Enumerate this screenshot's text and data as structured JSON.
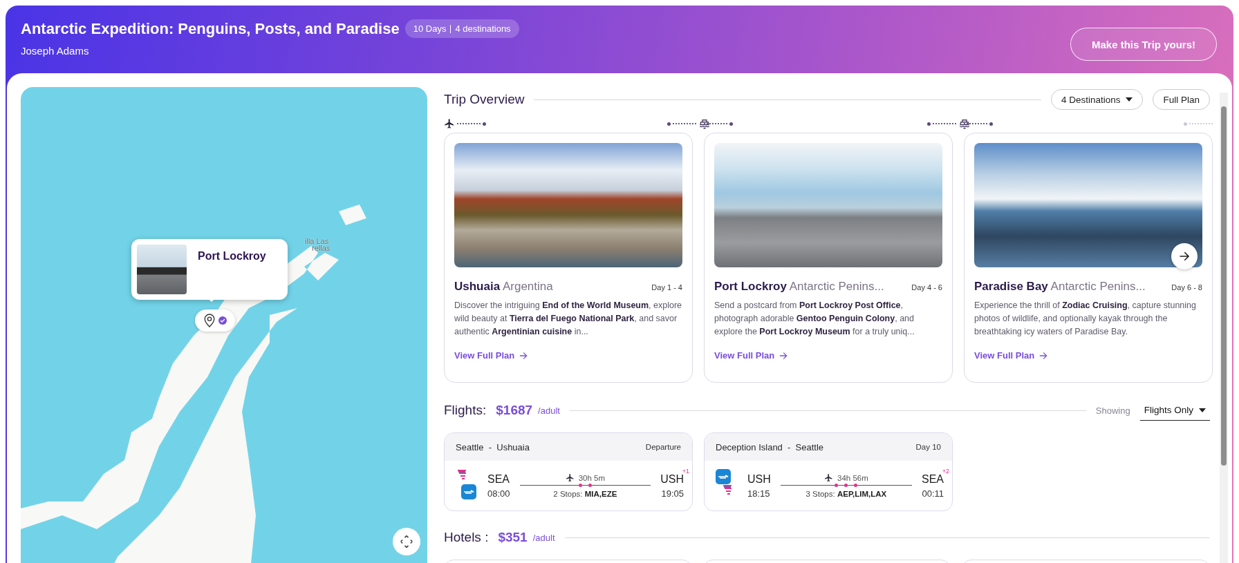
{
  "header": {
    "title": "Antarctic Expedition: Penguins, Posts, and Paradise",
    "badge_days": "10 Days",
    "badge_destinations": "4 destinations",
    "author": "Joseph Adams",
    "cta": "Make this Trip yours!"
  },
  "map": {
    "labels": [
      "illa Las",
      "rellas"
    ],
    "popup": {
      "title": "Port Lockroy"
    }
  },
  "overview": {
    "title": "Trip Overview",
    "destinations_dropdown": "4 Destinations",
    "full_plan": "Full Plan",
    "legs": [
      {
        "kind": "plane"
      },
      {
        "kind": "ship"
      },
      {
        "kind": "ship"
      }
    ],
    "cards": [
      {
        "name": "Ushuaia",
        "region": "Argentina",
        "days": "Day 1 - 4",
        "kind": "mountains",
        "description": "Discover the intriguing **End of the World Museum**, explore wild beauty at **Tierra del Fuego National Park**, and savor authentic **Argentinian cuisine** in...",
        "link": "View Full Plan"
      },
      {
        "name": "Port Lockroy",
        "region": "Antarctic Penins...",
        "days": "Day 4 - 6",
        "kind": "hut",
        "description": "Send a postcard from **Port Lockroy Post Office**, photograph adorable **Gentoo Penguin Colony**, and explore the **Port Lockroy Museum** for a truly uniq...",
        "link": "View Full Plan"
      },
      {
        "name": "Paradise Bay",
        "region": "Antarctic Penins...",
        "days": "Day 6 - 8",
        "kind": "glacier",
        "description": "Experience the thrill of **Zodiac Cruising**, capture stunning photos of wildlife, and optionally kayak through the breathtaking icy waters of Paradise Bay.",
        "link": "View Full Plan"
      }
    ]
  },
  "flights": {
    "title": "Flights:",
    "price": "$1687",
    "unit": "/adult",
    "showing": "Showing",
    "filter": "Flights Only",
    "items": [
      {
        "route": "Seattle  -  Ushuaia",
        "tag": "Departure",
        "airlines": [
          {
            "kind": "stripes"
          },
          {
            "kind": "tile"
          }
        ],
        "from_code": "SEA",
        "dep_time": "08:00",
        "duration": "30h 5m",
        "stops_label": "2 Stops:",
        "stops": "MIA,EZE",
        "to_code": "USH",
        "arr_time": "19:05",
        "day_offset": "+1"
      },
      {
        "route": "Deception Island  -  Seattle",
        "tag": "Day 10",
        "airlines": [
          {
            "kind": "tile"
          },
          {
            "kind": "stripes"
          }
        ],
        "from_code": "USH",
        "dep_time": "18:15",
        "duration": "34h 56m",
        "stops_label": "3 Stops:",
        "stops": "AEP,LIM,LAX",
        "to_code": "SEA",
        "arr_time": "00:11",
        "day_offset": "+2"
      }
    ]
  },
  "hotels": {
    "title": "Hotels :",
    "price": "$351",
    "unit": "/adult"
  }
}
